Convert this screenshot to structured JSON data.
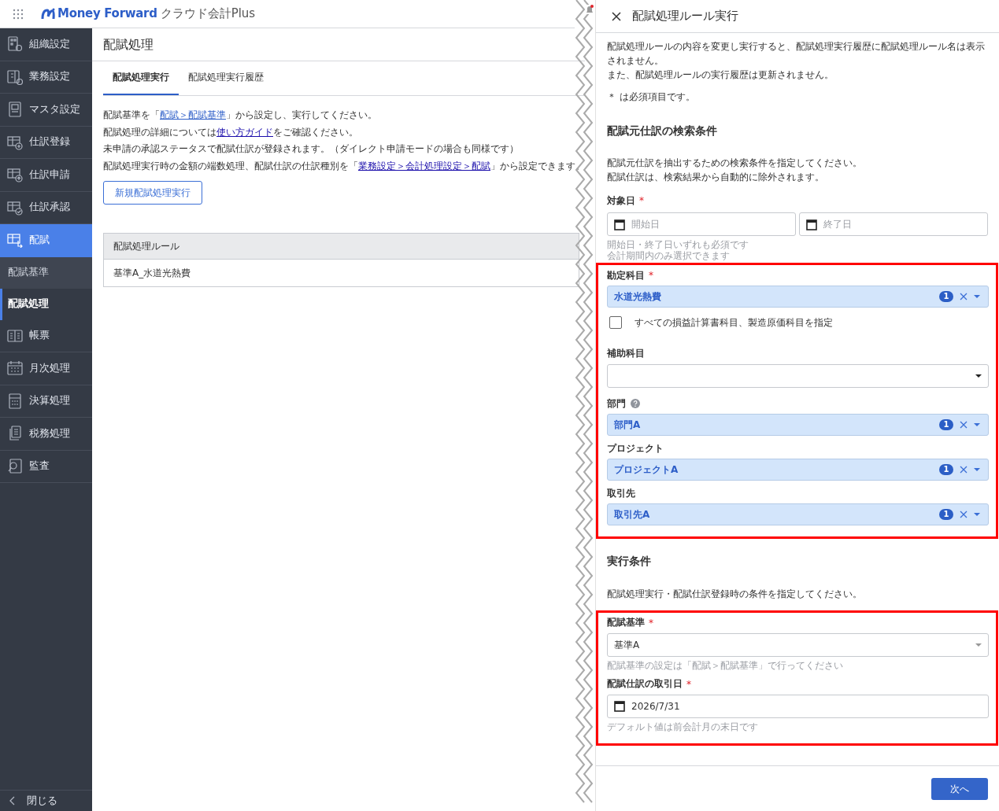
{
  "header": {
    "brand": "Money Forward",
    "product": "クラウド会計Plus"
  },
  "sidebar": {
    "items": [
      {
        "label": "組織設定",
        "selected": false
      },
      {
        "label": "業務設定",
        "selected": false
      },
      {
        "label": "マスタ設定",
        "selected": false
      },
      {
        "label": "仕訳登録",
        "selected": false
      },
      {
        "label": "仕訳申請",
        "selected": false
      },
      {
        "label": "仕訳承認",
        "selected": false
      },
      {
        "label": "配賦",
        "selected": true,
        "children": [
          {
            "label": "配賦基準",
            "selected": false
          },
          {
            "label": "配賦処理",
            "selected": true
          }
        ]
      },
      {
        "label": "帳票",
        "selected": false
      },
      {
        "label": "月次処理",
        "selected": false
      },
      {
        "label": "決算処理",
        "selected": false
      },
      {
        "label": "税務処理",
        "selected": false
      },
      {
        "label": "監査",
        "selected": false
      }
    ],
    "close_label": "閉じる"
  },
  "main": {
    "title": "配賦処理",
    "tabs": [
      {
        "label": "配賦処理実行",
        "selected": true
      },
      {
        "label": "配賦処理実行履歴",
        "selected": false
      }
    ],
    "paragraphs": [
      [
        {
          "text": "配賦基準を「"
        },
        {
          "link": "配賦＞配賦基準"
        },
        {
          "text": "」から設定し、実行してください。"
        }
      ],
      [
        {
          "text": "配賦処理の詳細については"
        },
        {
          "link": "使い方ガイド"
        },
        {
          "text": "をご確認ください。"
        }
      ],
      [
        {
          "text": "未申請の承認ステータスで配賦仕訳が登録されます。（ダイレクト申請モードの場合も同様です）"
        }
      ],
      [
        {
          "text": "配賦処理実行時の金額の端数処理、配賦仕訳の仕訳種別を「"
        },
        {
          "link": "業務設定＞会計処理設定＞配賦"
        },
        {
          "text": "」から設定できます。"
        }
      ]
    ],
    "new_button": "新規配賦処理実行",
    "table": {
      "columns": [
        "配賦処理ルール"
      ],
      "rows": [
        [
          "基準A_水道光熱費"
        ]
      ]
    }
  },
  "panel": {
    "title": "配賦処理ルール実行",
    "notes": [
      "配賦処理ルールの内容を変更し実行すると、配賦処理実行履歴に配賦処理ルール名は表示されません。",
      "また、配賦処理ルールの実行履歴は更新されません。"
    ],
    "required_note": "＊ は必須項目です。",
    "sections": [
      {
        "heading": "配賦元仕訳の検索条件",
        "description": [
          "配賦元仕訳を抽出するための検索条件を指定してください。",
          "配賦仕訳は、検索結果から自動的に除外されます。"
        ],
        "groups": [
          {
            "highlighted": false,
            "fields": [
              {
                "kind": "daterange",
                "label": "対象日",
                "required_mark": "*",
                "placeholders": [
                  "開始日",
                  "終了日"
                ],
                "hints": [
                  "開始日・終了日いずれも必須です",
                  "会計期間内のみ選択できます"
                ]
              }
            ]
          },
          {
            "highlighted": true,
            "fields": [
              {
                "kind": "multiselect",
                "label": "勘定科目",
                "required_mark": "*",
                "value": "水道光熱費",
                "count": "1"
              },
              {
                "kind": "checkbox",
                "label": "すべての損益計算書科目、製造原価科目を指定",
                "checked": false
              },
              {
                "kind": "select",
                "label": "補助科目"
              },
              {
                "kind": "multiselect",
                "label": "部門",
                "help": true,
                "value": "部門A",
                "count": "1"
              },
              {
                "kind": "multiselect",
                "label": "プロジェクト",
                "value": "プロジェクトA",
                "count": "1"
              },
              {
                "kind": "multiselect",
                "label": "取引先",
                "value": "取引先A",
                "count": "1"
              }
            ]
          }
        ]
      },
      {
        "heading": "実行条件",
        "description": [
          "配賦処理実行・配賦仕訳登録時の条件を指定してください。"
        ],
        "groups": [
          {
            "highlighted": true,
            "fields": [
              {
                "kind": "select",
                "label": "配賦基準",
                "required_mark": "*",
                "value": "基準A",
                "hints": [
                  "配賦基準の設定は「配賦＞配賦基準」で行ってください"
                ]
              },
              {
                "kind": "date",
                "label": "配賦仕訳の取引日",
                "required_mark": "*",
                "value": "2026/7/31",
                "hints": [
                  "デフォルト値は前会計月の末日です"
                ]
              }
            ]
          }
        ]
      }
    ],
    "next_button": "次へ"
  }
}
